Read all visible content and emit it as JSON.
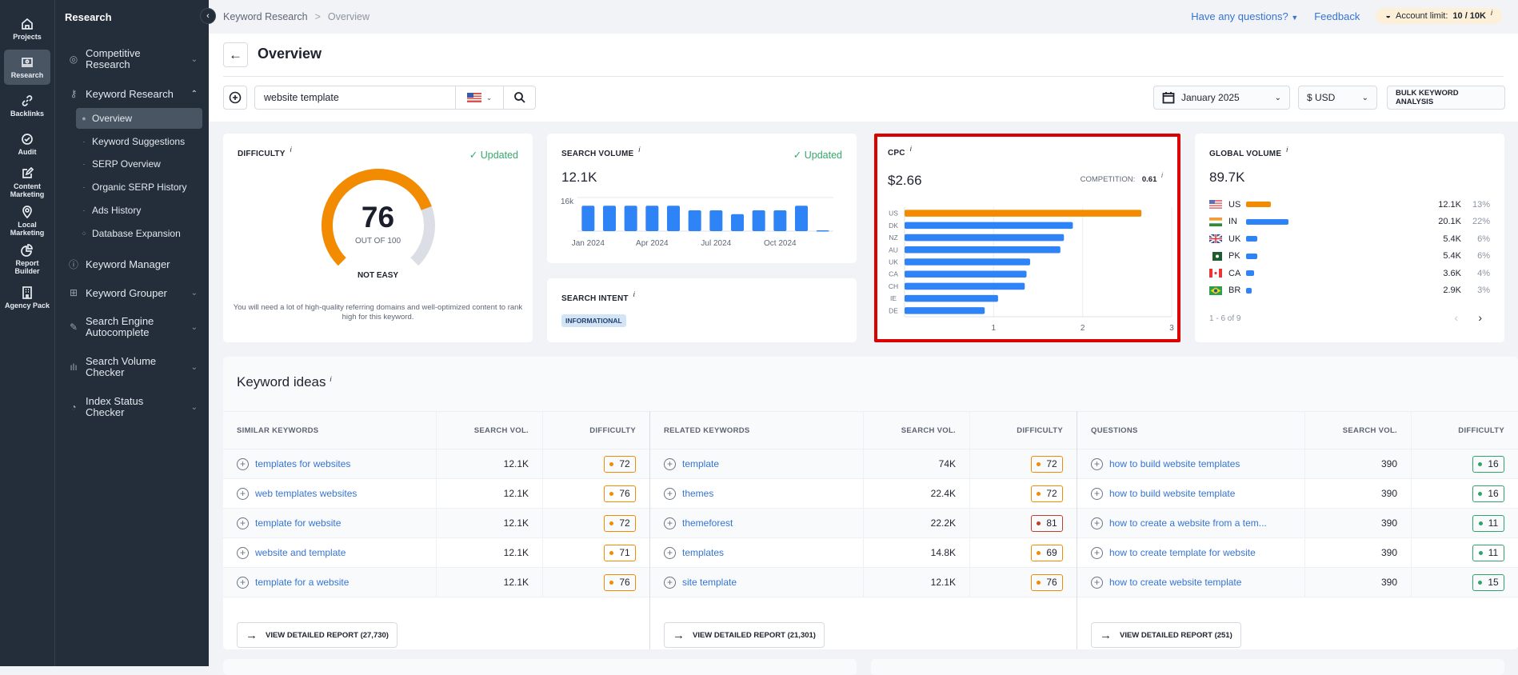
{
  "rail": [
    {
      "label": "Projects",
      "icon": "home-icon"
    },
    {
      "label": "Research",
      "icon": "research-icon",
      "active": true
    },
    {
      "label": "Backlinks",
      "icon": "link-icon"
    },
    {
      "label": "Audit",
      "icon": "check-circle-icon"
    },
    {
      "label": "Content Marketing",
      "icon": "edit-icon"
    },
    {
      "label": "Local Marketing",
      "icon": "location-pin-icon"
    },
    {
      "label": "Report Builder",
      "icon": "pie-chart-icon"
    },
    {
      "label": "Agency Pack",
      "icon": "building-icon"
    }
  ],
  "sidebar": {
    "title": "Research",
    "items": [
      {
        "label": "Competitive Research",
        "icon": "target-icon",
        "expanded": false
      },
      {
        "label": "Keyword Research",
        "icon": "key-icon",
        "expanded": true
      },
      {
        "label": "Keyword Manager",
        "icon": "info-circle-icon"
      },
      {
        "label": "Keyword Grouper",
        "icon": "folder-plus-icon",
        "expanded": false
      },
      {
        "label": "Search Engine Autocomplete",
        "icon": "pencil-icon",
        "expanded": false
      },
      {
        "label": "Search Volume Checker",
        "icon": "bar-chart-icon",
        "expanded": false
      },
      {
        "label": "Index Status Checker",
        "icon": "clock-icon",
        "expanded": false
      }
    ],
    "subitems": [
      {
        "label": "Overview",
        "active": true
      },
      {
        "label": "Keyword Suggestions"
      },
      {
        "label": "SERP Overview"
      },
      {
        "label": "Organic SERP History"
      },
      {
        "label": "Ads History"
      },
      {
        "label": "Database Expansion"
      }
    ]
  },
  "breadcrumb": {
    "parent": "Keyword Research",
    "separator": ">",
    "current": "Overview"
  },
  "topbar": {
    "questions": "Have any questions?",
    "feedback": "Feedback",
    "account_limit_label": "Account limit:",
    "account_limit_value": "10 / 10K"
  },
  "page": {
    "title": "Overview"
  },
  "search": {
    "value": "website template",
    "country": "US",
    "date": "January 2025",
    "currency": "$ USD",
    "bulk": "BULK KEYWORD ANALYSIS"
  },
  "difficulty": {
    "title": "DIFFICULTY",
    "status": "Updated",
    "score": 76,
    "max": 100,
    "out_of": "OUT OF 100",
    "label": "NOT EASY",
    "description": "You will need a lot of high-quality referring domains and well-optimized content to rank high for this keyword.",
    "color": "#f28b00"
  },
  "search_volume": {
    "title": "SEARCH VOLUME",
    "status": "Updated",
    "value": "12.1K",
    "ymax_label": "16k",
    "x_labels": [
      "Jan 2024",
      "Apr 2024",
      "Jul 2024",
      "Oct 2024"
    ],
    "months": [
      12100,
      12100,
      12100,
      12100,
      12100,
      9900,
      9900,
      8100,
      9900,
      9900,
      12100,
      400
    ]
  },
  "search_intent": {
    "title": "SEARCH INTENT",
    "tag": "INFORMATIONAL"
  },
  "cpc": {
    "title": "CPC",
    "value": "$2.66",
    "competition_label": "COMPETITION:",
    "competition_value": "0.61",
    "chart_data": {
      "type": "bar",
      "orientation": "horizontal",
      "categories": [
        "US",
        "DK",
        "NZ",
        "AU",
        "UK",
        "CA",
        "CH",
        "IE",
        "DE"
      ],
      "values": [
        2.66,
        1.89,
        1.79,
        1.75,
        1.41,
        1.37,
        1.35,
        1.05,
        0.9
      ],
      "xlim": [
        0,
        3
      ],
      "xticks": [
        "1",
        "2",
        "3"
      ],
      "highlight": "US"
    }
  },
  "global_volume": {
    "title": "GLOBAL VOLUME",
    "value": "89.7K",
    "pagination": "1 - 6 of 9",
    "rows": [
      {
        "code": "US",
        "volume": "12.1K",
        "pct": "13%",
        "share": 13,
        "highlight": true
      },
      {
        "code": "IN",
        "volume": "20.1K",
        "pct": "22%",
        "share": 22
      },
      {
        "code": "UK",
        "volume": "5.4K",
        "pct": "6%",
        "share": 6
      },
      {
        "code": "PK",
        "volume": "5.4K",
        "pct": "6%",
        "share": 6
      },
      {
        "code": "CA",
        "volume": "3.6K",
        "pct": "4%",
        "share": 4
      },
      {
        "code": "BR",
        "volume": "2.9K",
        "pct": "3%",
        "share": 3
      }
    ]
  },
  "keyword_ideas": {
    "title": "Keyword ideas",
    "columns": [
      {
        "header": "SIMILAR KEYWORDS",
        "vol_header": "SEARCH VOL.",
        "diff_header": "DIFFICULTY",
        "button": "VIEW DETAILED REPORT (27,730)",
        "rows": [
          {
            "kw": "templates for websites",
            "vol": "12.1K",
            "diff": "72",
            "level": "orange"
          },
          {
            "kw": "web templates websites",
            "vol": "12.1K",
            "diff": "76",
            "level": "orange"
          },
          {
            "kw": "template for website",
            "vol": "12.1K",
            "diff": "72",
            "level": "orange"
          },
          {
            "kw": "website and template",
            "vol": "12.1K",
            "diff": "71",
            "level": "orange"
          },
          {
            "kw": "template for a website",
            "vol": "12.1K",
            "diff": "76",
            "level": "orange"
          }
        ]
      },
      {
        "header": "RELATED KEYWORDS",
        "vol_header": "SEARCH VOL.",
        "diff_header": "DIFFICULTY",
        "button": "VIEW DETAILED REPORT (21,301)",
        "rows": [
          {
            "kw": "template",
            "vol": "74K",
            "diff": "72",
            "level": "orange"
          },
          {
            "kw": "themes",
            "vol": "22.4K",
            "diff": "72",
            "level": "orange"
          },
          {
            "kw": "themeforest",
            "vol": "22.2K",
            "diff": "81",
            "level": "red"
          },
          {
            "kw": "templates",
            "vol": "14.8K",
            "diff": "69",
            "level": "orange"
          },
          {
            "kw": "site template",
            "vol": "12.1K",
            "diff": "76",
            "level": "orange"
          }
        ]
      },
      {
        "header": "QUESTIONS",
        "vol_header": "SEARCH VOL.",
        "diff_header": "DIFFICULTY",
        "button": "VIEW DETAILED REPORT (251)",
        "rows": [
          {
            "kw": "how to build website templates",
            "vol": "390",
            "diff": "16",
            "level": "green"
          },
          {
            "kw": "how to build website template",
            "vol": "390",
            "diff": "16",
            "level": "green"
          },
          {
            "kw": "how to create a website from a tem...",
            "vol": "390",
            "diff": "11",
            "level": "green"
          },
          {
            "kw": "how to create template for website",
            "vol": "390",
            "diff": "11",
            "level": "green"
          },
          {
            "kw": "how to create website template",
            "vol": "390",
            "diff": "15",
            "level": "green"
          }
        ]
      }
    ]
  }
}
